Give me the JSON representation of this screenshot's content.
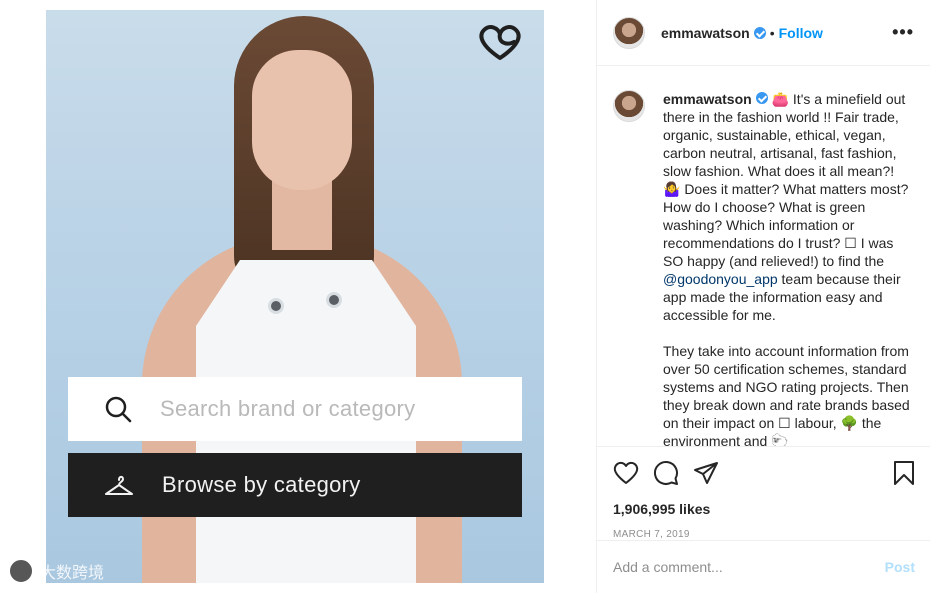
{
  "post": {
    "overlay": {
      "search_placeholder": "Search brand or category",
      "browse_label": "Browse by category"
    },
    "watermark_text": "大数跨境"
  },
  "header": {
    "username": "emmawatson",
    "separator": "•",
    "follow_label": "Follow",
    "more_label": "•••"
  },
  "caption": {
    "username": "emmawatson",
    "line1": " 👛 It's a minefield out there in the fashion world !! Fair trade, organic, sustainable, ethical, vegan, carbon neutral, artisanal, fast fashion, slow fashion. What does it all mean?! 🤷‍♀️ Does it matter? What matters most? How do I choose? What is green washing? Which information or recommendations do I trust? ☐ I was SO happy (and relieved!) to find the ",
    "mention": "@goodonyou_app",
    "line2": " team because their app made the information easy and accessible for me.",
    "para2": "They take into account information from over 50 certification schemes, standard systems and NGO rating projects. Then they break down and rate brands based on their impact on ☐ labour, 🌳 the environment and 🐑"
  },
  "actions": {
    "likes": "1,906,995 likes",
    "date": "MARCH 7, 2019"
  },
  "comment": {
    "placeholder": "Add a comment...",
    "post_label": "Post"
  },
  "colors": {
    "accent": "#0095f6",
    "verified": "#3897f0",
    "post_disabled": "#b2dffc"
  }
}
